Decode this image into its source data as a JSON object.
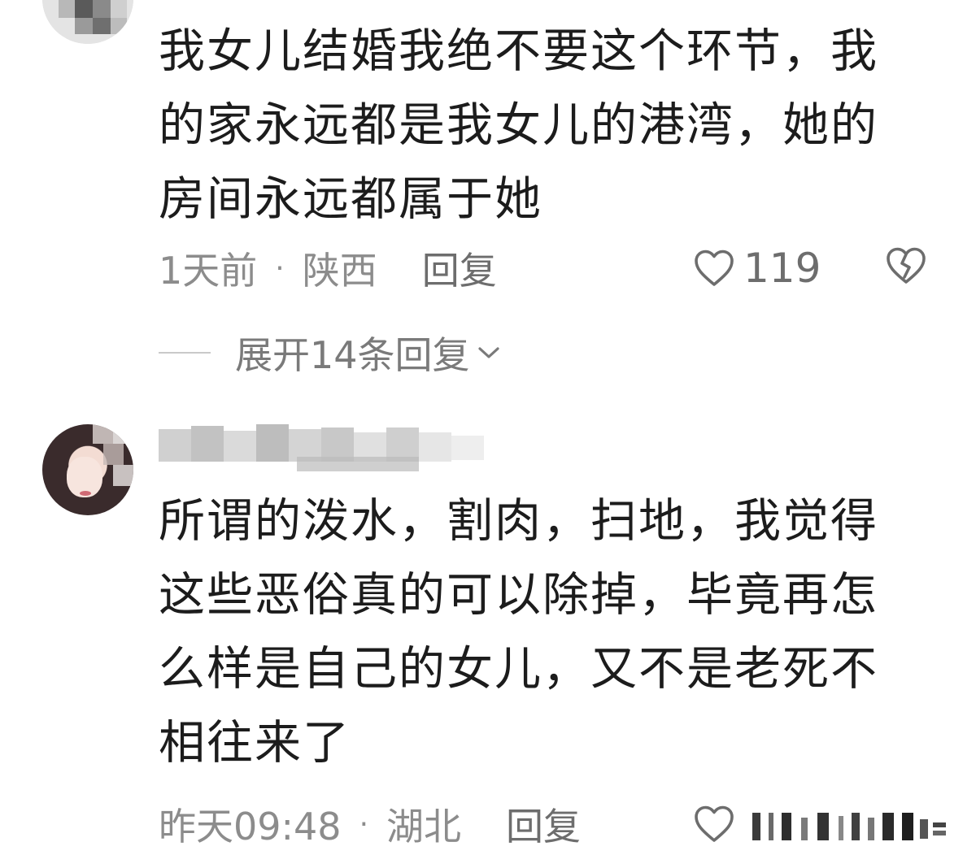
{
  "comments": [
    {
      "text": "我女儿结婚我绝不要这个环节，我的家永远都是我女儿的港湾，她的房间永远都属于她",
      "lines": [
        "我女儿结婚我绝不要这个环节，我",
        "的家永远都是我女儿的港湾，她的",
        "房间永远都属于她"
      ],
      "time": "1天前",
      "location": "陕西",
      "reply_label": "回复",
      "likes": "119",
      "expand_label": "展开14条回复"
    },
    {
      "lines": [
        "所谓的泼水，割肉，扫地，我觉得",
        "这些恶俗真的可以除掉，毕竟再怎",
        "么样是自己的女儿，又不是老死不",
        "相往来了"
      ],
      "time": "昨天09:48",
      "location": "湖北",
      "reply_label": "回复"
    }
  ],
  "separator": "·",
  "icons": {
    "like": "heart-outline-icon",
    "dislike": "broken-heart-icon",
    "expand": "chevron-down-icon"
  },
  "colors": {
    "text": "#1c1c1c",
    "meta": "#8c8c8c",
    "icon": "#6d6d6d"
  }
}
